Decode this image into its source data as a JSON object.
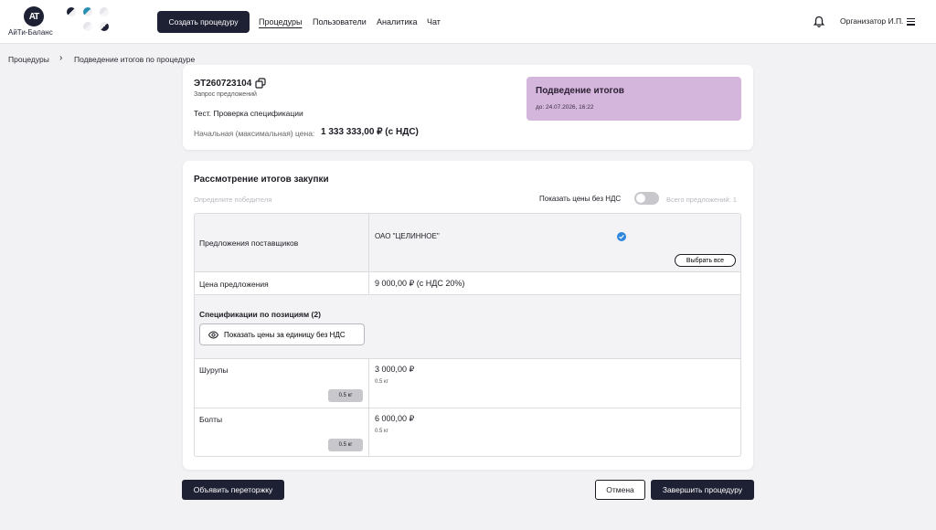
{
  "header": {
    "logo_mark": "AT",
    "logo_text": "АйТи-Баланс",
    "create_button": "Создать процедуру",
    "nav": [
      "Процедуры",
      "Пользователи",
      "Аналитика",
      "Чат"
    ],
    "user_name": "Организатор И.П.",
    "icons": [
      "bell-icon",
      "menu-icon"
    ]
  },
  "breadcrumb": {
    "items": [
      "Процедуры",
      "Подведение итогов по процедуре"
    ]
  },
  "procedure": {
    "id": "ЭТ260723104",
    "type": "Запрос предложений",
    "name": "Тест. Проверка спецификации",
    "price_label": "Начальная (максимальная) цена:",
    "price_value": "1 333 333,00 ₽ (с НДС)",
    "status_title": "Подведение итогов",
    "status_date": "до: 24.07.2026, 16:22",
    "status_color": "#d4b6dc"
  },
  "results": {
    "title": "Рассмотрение итогов закупки",
    "hint": "Определите победителя",
    "vat_toggle_label": "Показать цены без НДС",
    "total_offers": "Всего предложений: 1",
    "table": {
      "offers_label": "Предложения поставщиков",
      "supplier": "ОАО \"ЦЕЛИННОЕ\"",
      "select_all": "Выбрать все",
      "price_label": "Цена предложения",
      "price_value": "9 000,00 ₽ (с НДС 20%)",
      "spec_label": "Спецификации по позициям (2)",
      "show_unit_prices": "Показать цены за единицу без НДС",
      "items": [
        {
          "name": "Шурупы",
          "unit": "0.5 кг",
          "price": "3 000,00 ₽",
          "qty": "0.5 кг"
        },
        {
          "name": "Болты",
          "unit": "0.5 кг",
          "price": "6 000,00 ₽",
          "qty": "0.5 кг"
        }
      ]
    }
  },
  "actions": {
    "rebid": "Объявить переторжку",
    "cancel": "Отмена",
    "finish": "Завершить процедуру"
  }
}
